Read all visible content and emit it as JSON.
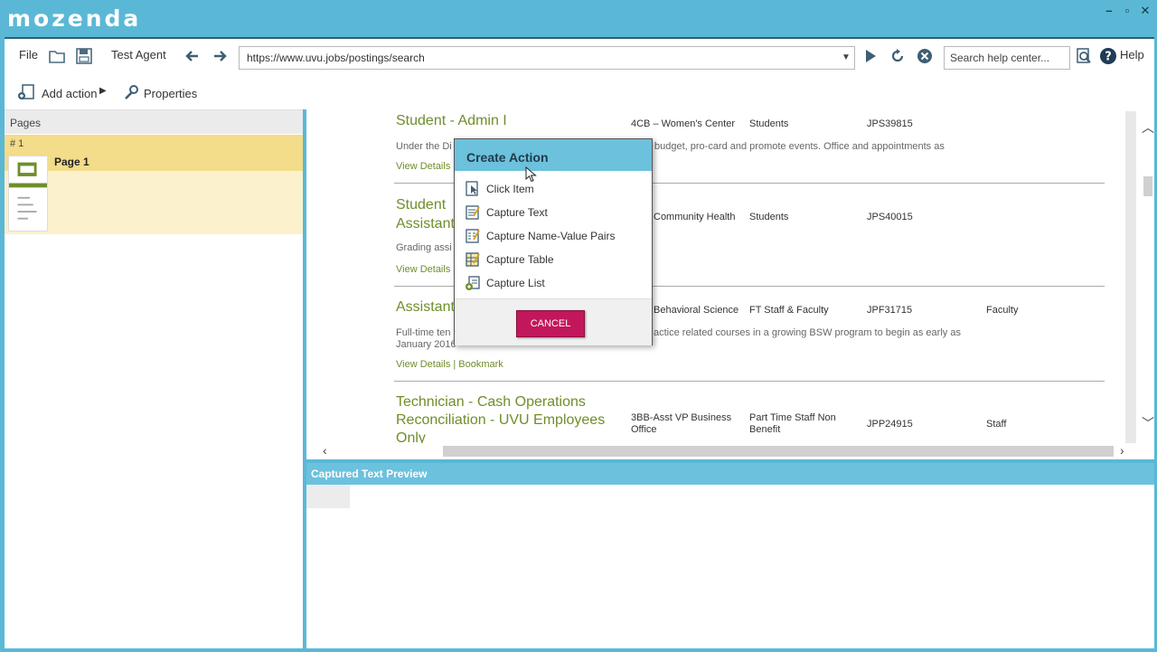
{
  "app": {
    "logo": "mozenda",
    "window_controls": [
      "–",
      "▫",
      "✕"
    ]
  },
  "toolbar": {
    "file": "File",
    "agent_name": "Test Agent",
    "url": "https://www.uvu.jobs/postings/search",
    "search_placeholder": "Search help center...",
    "help": "Help",
    "add_action": "Add action",
    "properties": "Properties"
  },
  "pages": {
    "header": "Pages",
    "page_number": "# 1",
    "page_label": "Page 1"
  },
  "jobs": [
    {
      "title": "Student - Admin I",
      "department": "4CB – Women's Center",
      "type": "Students",
      "id": "JPS39815",
      "category": "",
      "desc": "Under the Di",
      "desc2": "budget, pro-card and promote events. Office and appointments as",
      "link": "View Details |"
    },
    {
      "title_lines": [
        "Student",
        "Assistant"
      ],
      "department": "Community Health",
      "type": "Students",
      "id": "JPS40015",
      "category": "",
      "desc": "Grading assi",
      "link": "View Details |"
    },
    {
      "title": "Assistant",
      "department": "Behavioral Science",
      "type": "FT Staff & Faculty",
      "id": "JPF31715",
      "category": "Faculty",
      "desc_lines": [
        "Full-time ten",
        "January 2016"
      ],
      "desc2": "actice related courses in a growing BSW program to begin as early as",
      "link": "View Details | Bookmark"
    },
    {
      "title_lines": [
        "Technician - Cash Operations",
        "Reconciliation - UVU Employees",
        "Only"
      ],
      "department_lines": [
        "3BB-Asst VP Business",
        "Office"
      ],
      "type_lines": [
        "Part Time Staff Non",
        "Benefit"
      ],
      "id": "JPP24915",
      "category": "Staff"
    }
  ],
  "preview": {
    "title": "Captured Text Preview"
  },
  "popup": {
    "title": "Create Action",
    "items": [
      {
        "label": "Click Item",
        "icon": "click-item-icon"
      },
      {
        "label": "Capture Text",
        "icon": "capture-text-icon"
      },
      {
        "label": "Capture Name-Value Pairs",
        "icon": "capture-name-value-icon"
      },
      {
        "label": "Capture Table",
        "icon": "capture-table-icon"
      },
      {
        "label": "Capture List",
        "icon": "capture-list-icon"
      }
    ],
    "cancel": "CANCEL"
  },
  "colors": {
    "brand": "#5ab8d6",
    "header_blue": "#6cc1dd",
    "job_title_green": "#6f8e2a",
    "cancel_magenta": "#c2185b",
    "page_selected": "#f3dc8a"
  }
}
